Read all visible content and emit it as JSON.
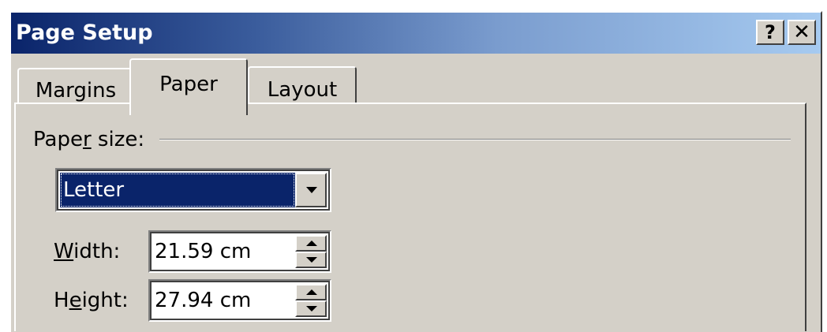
{
  "window": {
    "title": "Page Setup",
    "help_glyph": "?",
    "close_glyph": "✕"
  },
  "tabs": [
    {
      "label": "Margins",
      "selected": false
    },
    {
      "label": "Paper",
      "selected": true
    },
    {
      "label": "Layout",
      "selected": false
    }
  ],
  "paper_size": {
    "label_before": "Pape",
    "label_mnemonic": "r",
    "label_after": " size:",
    "selected_value": "Letter"
  },
  "width": {
    "label_mnemonic": "W",
    "label_after": "idth:",
    "value": "21.59 cm"
  },
  "height": {
    "label_before": "H",
    "label_mnemonic": "e",
    "label_after": "ight:",
    "value": "27.94 cm"
  },
  "colors": {
    "titlebar_start": "#0a246a",
    "titlebar_end": "#a6caf0",
    "face": "#d4d0c8",
    "selection": "#0a246a"
  },
  "icons": {
    "help": "help-icon",
    "close": "close-icon",
    "dropdown": "chevron-down-icon",
    "spin_up": "arrow-up-icon",
    "spin_down": "arrow-down-icon"
  }
}
